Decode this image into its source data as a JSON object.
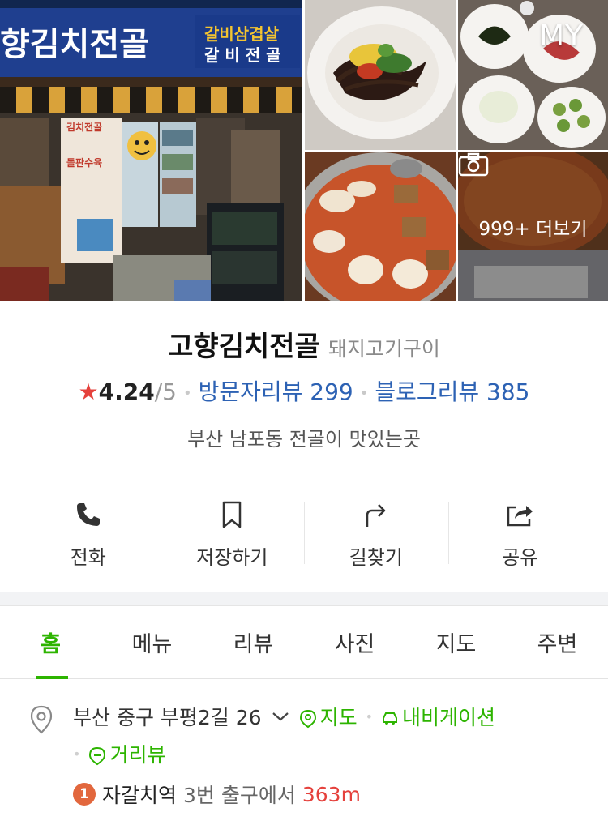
{
  "photos": {
    "main_sign_left": "향김치전골",
    "main_sign_right_1": "갈비삼겹살",
    "main_sign_right_2": "갈 비 전 골",
    "door_text_1": "김치전골",
    "door_text_2": "돌판수육",
    "corner_badge": "MY",
    "more_label": "999+ 더보기",
    "more_icon": "camera-icon"
  },
  "place": {
    "name": "고향김치전골",
    "category": "돼지고기구이",
    "rating_star": "★",
    "rating_score": "4.24",
    "rating_max": "/5",
    "visitor_reviews": "방문자리뷰 299",
    "blog_reviews": "블로그리뷰 385",
    "tagline": "부산 남포동 전골이 맛있는곳"
  },
  "actions": [
    {
      "label": "전화",
      "icon": "phone-icon"
    },
    {
      "label": "저장하기",
      "icon": "bookmark-icon"
    },
    {
      "label": "길찾기",
      "icon": "directions-icon"
    },
    {
      "label": "공유",
      "icon": "share-icon"
    }
  ],
  "tabs": [
    {
      "label": "홈",
      "active": true
    },
    {
      "label": "메뉴",
      "active": false
    },
    {
      "label": "리뷰",
      "active": false
    },
    {
      "label": "사진",
      "active": false
    },
    {
      "label": "지도",
      "active": false
    },
    {
      "label": "주변",
      "active": false
    }
  ],
  "address": {
    "text": "부산 중구 부평2길 26",
    "map_link": "지도",
    "navi_link": "내비게이션",
    "street_view_link": "거리뷰",
    "station_number": "1",
    "station_name": "자갈치역",
    "station_exit": "3번 출구에서",
    "station_distance": "363m"
  },
  "colors": {
    "accent_green": "#2db400",
    "link_blue": "#2d62b4",
    "star_red": "#e5413c",
    "station_badge": "#e2673d"
  }
}
